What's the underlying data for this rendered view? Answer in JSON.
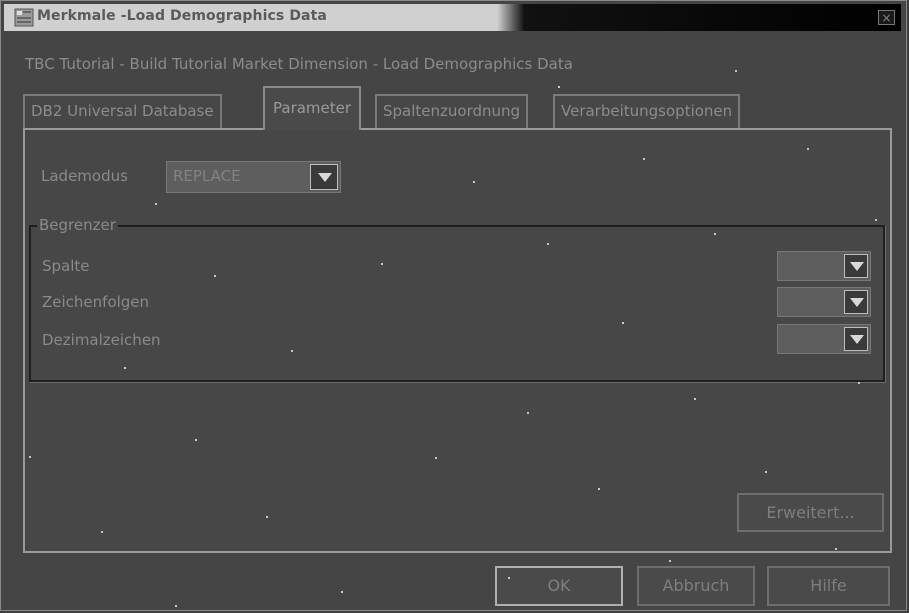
{
  "window": {
    "title": "Merkmale -Load Demographics Data",
    "close_label": "×"
  },
  "subtitle": "TBC Tutorial - Build Tutorial Market Dimension - Load Demographics Data",
  "tabs": [
    {
      "label": "DB2 Universal Database",
      "active": false
    },
    {
      "label": "Parameter",
      "active": true
    },
    {
      "label": "Spaltenzuordnung",
      "active": false
    },
    {
      "label": "Verarbeitungsoptionen",
      "active": false
    }
  ],
  "parameter": {
    "lademodus_label": "Lademodus",
    "lademodus_value": "REPLACE",
    "begrenzer": {
      "legend": "Begrenzer",
      "spalte_label": "Spalte",
      "zeichenfolgen_label": "Zeichenfolgen",
      "dezimalzeichen_label": "Dezimalzeichen"
    },
    "erweitert_label": "Erweitert..."
  },
  "buttons": {
    "ok": "OK",
    "abbruch": "Abbruch",
    "hilfe": "Hilfe"
  }
}
